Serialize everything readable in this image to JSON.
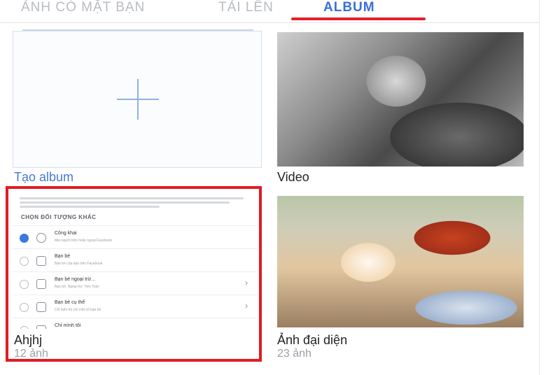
{
  "tabs": {
    "faces": "ẢNH CÓ MẶT BẠN",
    "uploads": "TẢI LÊN",
    "album": "ALBUM"
  },
  "albums": {
    "create_label": "Tạo album",
    "video_label": "Video",
    "ahjhj_label": "Ahjhj",
    "ahjhj_count": "12 ảnh",
    "profile_label": "Ảnh đại diện",
    "profile_count": "23 ảnh"
  },
  "cover": {
    "section_title": "CHỌN ĐỐI TƯỢNG KHÁC",
    "options": [
      {
        "title": "Công khai",
        "sub": "Mọi người trên hoặc ngoài Facebook"
      },
      {
        "title": "Bạn bè",
        "sub": "Bạn bè của bạn trên Facebook"
      },
      {
        "title": "Bạn bè ngoại trừ...",
        "sub": "Bạn bè; Ngoại trừ: Tiến Toàn"
      },
      {
        "title": "Bạn bè cụ thể",
        "sub": "Chỉ hiển thị với một số bạn bè"
      },
      {
        "title": "Chỉ mình tôi",
        "sub": ""
      }
    ]
  },
  "colors": {
    "accent": "#3b6fd8",
    "highlight": "#e21b22"
  },
  "icons": {
    "create": "plus-icon",
    "selected": "radio-checked",
    "globe": "globe-icon",
    "friends": "friends-icon",
    "chevron": "chevron-right-icon"
  }
}
